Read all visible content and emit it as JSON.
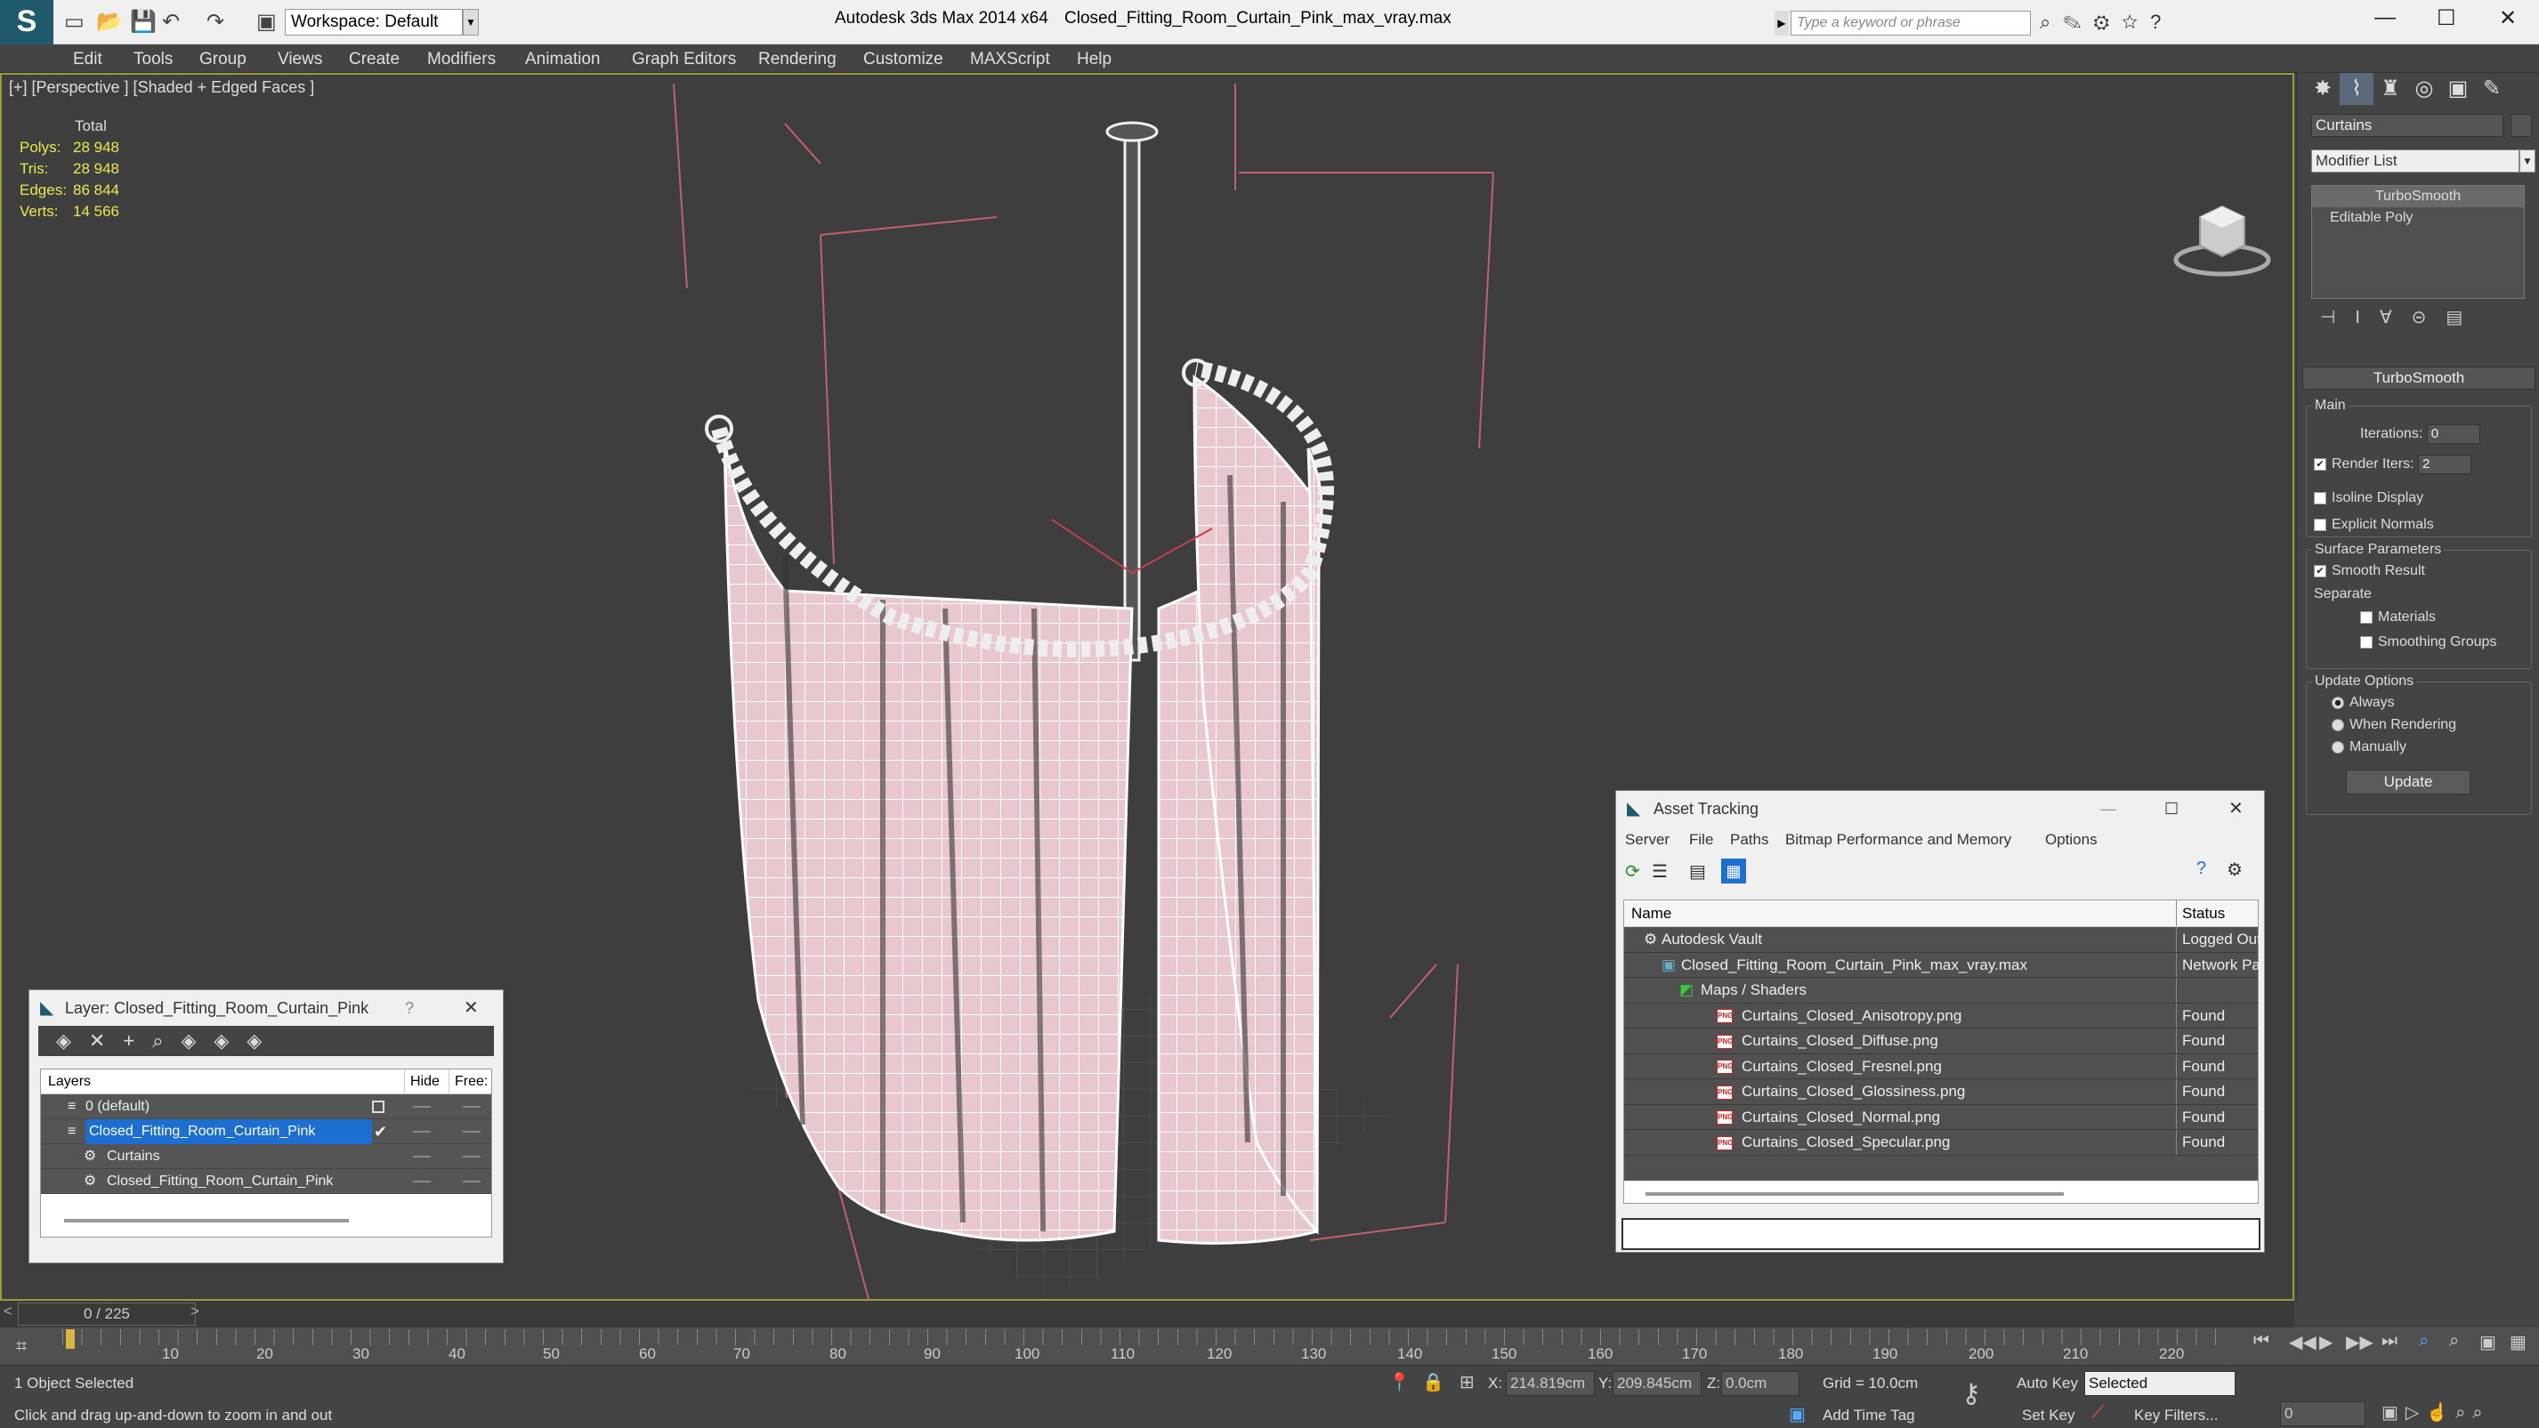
{
  "app": {
    "title": "Autodesk 3ds Max  2014 x64",
    "file": "Closed_Fitting_Room_Curtain_Pink_max_vray.max",
    "workspace": "Workspace: Default",
    "search_placeholder": "Type a keyword or phrase"
  },
  "menu": [
    "Edit",
    "Tools",
    "Group",
    "Views",
    "Create",
    "Modifiers",
    "Animation",
    "Graph Editors",
    "Rendering",
    "Customize",
    "MAXScript",
    "Help"
  ],
  "viewport": {
    "label": "[+] [Perspective ] [Shaded + Edged Faces ]",
    "stats_header": "Total",
    "stats": [
      {
        "label": "Polys:",
        "value": "28 948"
      },
      {
        "label": "Tris:",
        "value": "28 948"
      },
      {
        "label": "Edges:",
        "value": "86 844"
      },
      {
        "label": "Verts:",
        "value": "14 566"
      }
    ]
  },
  "command_panel": {
    "object_name": "Curtains",
    "modifier_list": "Modifier List",
    "stack": [
      "TurboSmooth",
      "Editable Poly"
    ],
    "rollout_title": "TurboSmooth",
    "main_group": "Main",
    "iterations_label": "Iterations:",
    "iterations_value": "0",
    "render_iters_label": "Render Iters:",
    "render_iters_value": "2",
    "isoline": "Isoline Display",
    "explicit": "Explicit Normals",
    "surface_group": "Surface Parameters",
    "smooth_result": "Smooth Result",
    "separate": "Separate",
    "materials": "Materials",
    "smoothing_groups": "Smoothing Groups",
    "update_group": "Update Options",
    "always": "Always",
    "when_rendering": "When Rendering",
    "manually": "Manually",
    "update_button": "Update"
  },
  "layer_window": {
    "title": "Layer: Closed_Fitting_Room_Curtain_Pink",
    "help": "?",
    "col_layers": "Layers",
    "col_hide": "Hide",
    "col_freeze": "Free:",
    "rows": [
      {
        "name": "0 (default)"
      },
      {
        "name": "Closed_Fitting_Room_Curtain_Pink"
      },
      {
        "name": "Curtains"
      },
      {
        "name": "Closed_Fitting_Room_Curtain_Pink"
      }
    ]
  },
  "asset_window": {
    "title": "Asset Tracking",
    "menu": [
      "Server",
      "File",
      "Paths",
      "Bitmap Performance and Memory",
      "Options"
    ],
    "col_name": "Name",
    "col_status": "Status",
    "rows": [
      {
        "name": "Autodesk Vault",
        "status": "Logged Out"
      },
      {
        "name": "Closed_Fitting_Room_Curtain_Pink_max_vray.max",
        "status": "Network Pa"
      },
      {
        "name": "Maps / Shaders",
        "status": ""
      },
      {
        "name": "Curtains_Closed_Anisotropy.png",
        "status": "Found"
      },
      {
        "name": "Curtains_Closed_Diffuse.png",
        "status": "Found"
      },
      {
        "name": "Curtains_Closed_Fresnel.png",
        "status": "Found"
      },
      {
        "name": "Curtains_Closed_Glossiness.png",
        "status": "Found"
      },
      {
        "name": "Curtains_Closed_Normal.png",
        "status": "Found"
      },
      {
        "name": "Curtains_Closed_Specular.png",
        "status": "Found"
      }
    ]
  },
  "timeline": {
    "slider": "0 / 225",
    "ticks": [
      "10",
      "20",
      "30",
      "40",
      "50",
      "60",
      "70",
      "80",
      "90",
      "100",
      "110",
      "120",
      "130",
      "140",
      "150",
      "160",
      "170",
      "180",
      "190",
      "200",
      "210",
      "220"
    ]
  },
  "status": {
    "selected": "1 Object Selected",
    "prompt": "Click and drag up-and-down to zoom in and out",
    "x_label": "X:",
    "x_value": "214.819cm",
    "y_label": "Y:",
    "y_value": "209.845cm",
    "z_label": "Z:",
    "z_value": "0.0cm",
    "grid": "Grid = 10.0cm",
    "add_time_tag": "Add Time Tag",
    "auto_key": "Auto Key",
    "set_key": "Set Key",
    "selected_dropdown": "Selected",
    "key_filters": "Key Filters...",
    "frame": "0"
  },
  "colors": {
    "curtain": "#e8c8cc",
    "selection": "#1c6fd0",
    "stats": "#e8e850"
  }
}
